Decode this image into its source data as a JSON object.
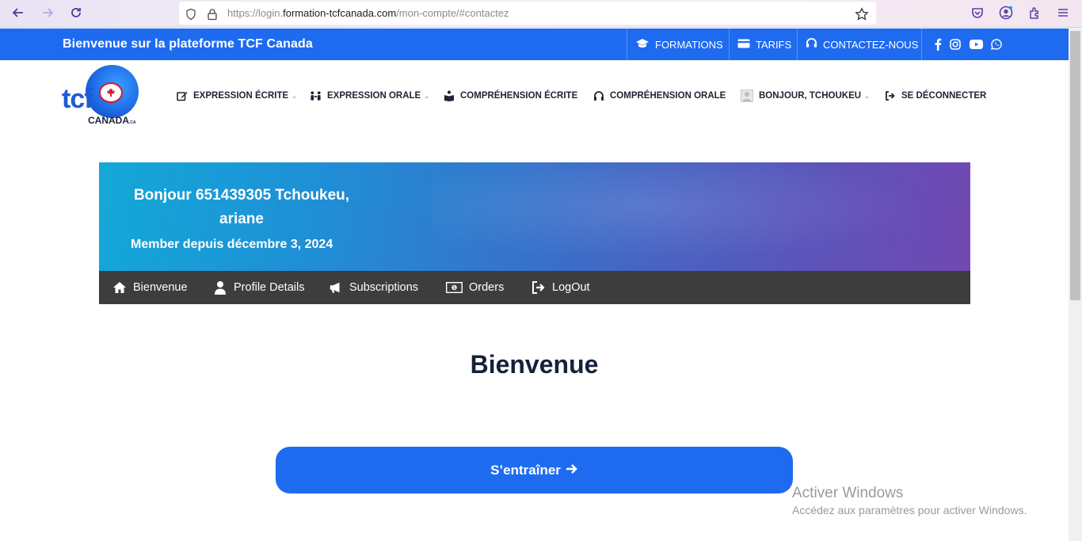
{
  "browser": {
    "url_prefix": "https://login.",
    "url_domain": "formation-tcfcanada.com",
    "url_path": "/mon-compte/#contactez"
  },
  "topbar": {
    "title": "Bienvenue sur la plateforme TCF Canada",
    "links": [
      "FORMATIONS",
      "TARIFS",
      "CONTACTEZ-NOUS"
    ]
  },
  "logo": {
    "tcf": "tcf",
    "canada": "CANADA",
    "ca": ".CA"
  },
  "menu": {
    "items": [
      "EXPRESSION ÉCRITE",
      "EXPRESSION ORALE",
      "COMPRÉHENSION ÉCRITE",
      "COMPRÉHENSION ORALE",
      "BONJOUR, TCHOUKEU",
      "SE DÉCONNECTER"
    ]
  },
  "banner": {
    "hello_line1": "Bonjour 651439305 Tchoukeu,",
    "hello_line2": "ariane",
    "member": "Member depuis décembre 3, 2024"
  },
  "account_nav": {
    "items": [
      "Bienvenue",
      "Profile Details",
      "Subscriptions",
      "Orders",
      "LogOut"
    ]
  },
  "main": {
    "title": "Bienvenue",
    "cta": "S’entraîner"
  },
  "windows": {
    "line1": "Activer Windows",
    "line2": "Accédez aux paramètres pour activer Windows."
  },
  "colors": {
    "brand_blue": "#1f6bf0",
    "dark_nav": "#3d3d3d",
    "title_dark": "#16213a"
  }
}
